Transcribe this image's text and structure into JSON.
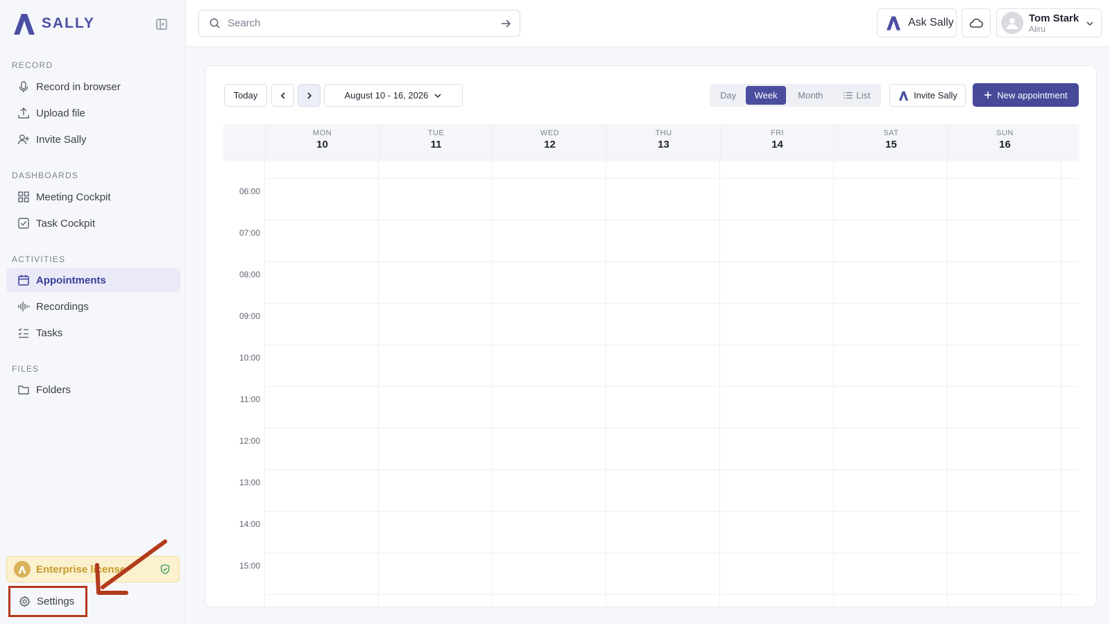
{
  "app": {
    "name": "SALLY"
  },
  "sidebar": {
    "sections": [
      {
        "title": "RECORD",
        "items": [
          {
            "label": "Record in browser",
            "icon": "microphone-icon"
          },
          {
            "label": "Upload file",
            "icon": "upload-icon"
          },
          {
            "label": "Invite Sally",
            "icon": "user-plus-icon"
          }
        ]
      },
      {
        "title": "DASHBOARDS",
        "items": [
          {
            "label": "Meeting Cockpit",
            "icon": "grid-icon"
          },
          {
            "label": "Task Cockpit",
            "icon": "checkbox-icon"
          }
        ]
      },
      {
        "title": "ACTIVITIES",
        "items": [
          {
            "label": "Appointments",
            "icon": "calendar-icon",
            "active": true
          },
          {
            "label": "Recordings",
            "icon": "waveform-icon"
          },
          {
            "label": "Tasks",
            "icon": "checklist-icon"
          }
        ]
      },
      {
        "title": "FILES",
        "items": [
          {
            "label": "Folders",
            "icon": "folder-icon"
          }
        ]
      }
    ],
    "license_label": "Enterprise license",
    "settings_label": "Settings"
  },
  "topbar": {
    "search_placeholder": "Search",
    "ask_label": "Ask Sally",
    "user": {
      "name": "Tom Stark",
      "org": "Aliru"
    }
  },
  "calendar": {
    "today_label": "Today",
    "range_label": "August 10 - 16, 2026",
    "views": [
      {
        "label": "Day",
        "active": false
      },
      {
        "label": "Week",
        "active": true
      },
      {
        "label": "Month",
        "active": false
      },
      {
        "label": "List",
        "active": false
      }
    ],
    "invite_label": "Invite Sally",
    "new_label": "New appointment",
    "days": [
      {
        "name": "MON",
        "num": "10"
      },
      {
        "name": "TUE",
        "num": "11"
      },
      {
        "name": "WED",
        "num": "12"
      },
      {
        "name": "THU",
        "num": "13"
      },
      {
        "name": "FRI",
        "num": "14"
      },
      {
        "name": "SAT",
        "num": "15"
      },
      {
        "name": "SUN",
        "num": "16"
      }
    ],
    "times": [
      "06:00",
      "07:00",
      "08:00",
      "09:00",
      "10:00",
      "11:00",
      "12:00",
      "13:00",
      "14:00",
      "15:00"
    ]
  },
  "colors": {
    "accent": "#464a99",
    "active_bg": "#e9e9f8",
    "license_bg": "#fbf1cf",
    "highlight": "#b33a1c"
  }
}
